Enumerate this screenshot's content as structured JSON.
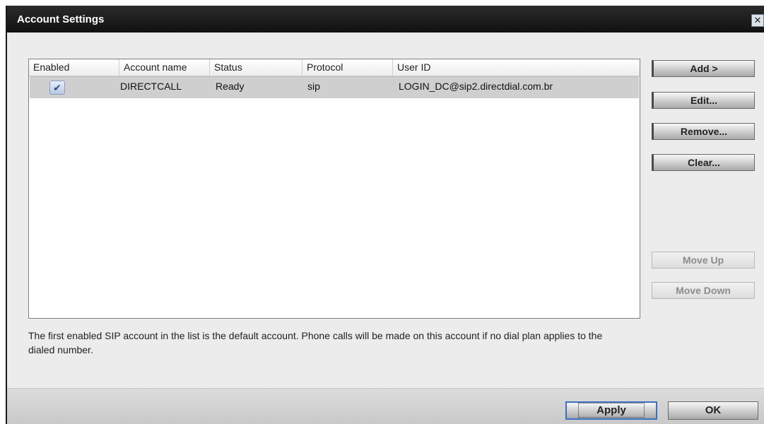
{
  "window": {
    "title": "Account Settings",
    "close_icon": "close-icon"
  },
  "table": {
    "columns": [
      "Enabled",
      "Account name",
      "Status",
      "Protocol",
      "User ID"
    ],
    "rows": [
      {
        "enabled": true,
        "account_name": "DIRECTCALL",
        "status": "Ready",
        "protocol": "sip",
        "user_id": "LOGIN_DC@sip2.directdial.com.br"
      }
    ]
  },
  "buttons": {
    "add": "Add >",
    "edit": "Edit...",
    "remove": "Remove...",
    "clear": "Clear...",
    "move_up": "Move Up",
    "move_down": "Move Down",
    "apply": "Apply",
    "ok": "OK"
  },
  "info_text": "The first enabled SIP account in the list is the default account. Phone calls will be made on this account if no dial plan applies to the dialed number.",
  "colors": {
    "titlebar": "#1a1a1a",
    "selected_row": "#cfcfcf",
    "apply_focus_border": "#3c6fc0"
  }
}
